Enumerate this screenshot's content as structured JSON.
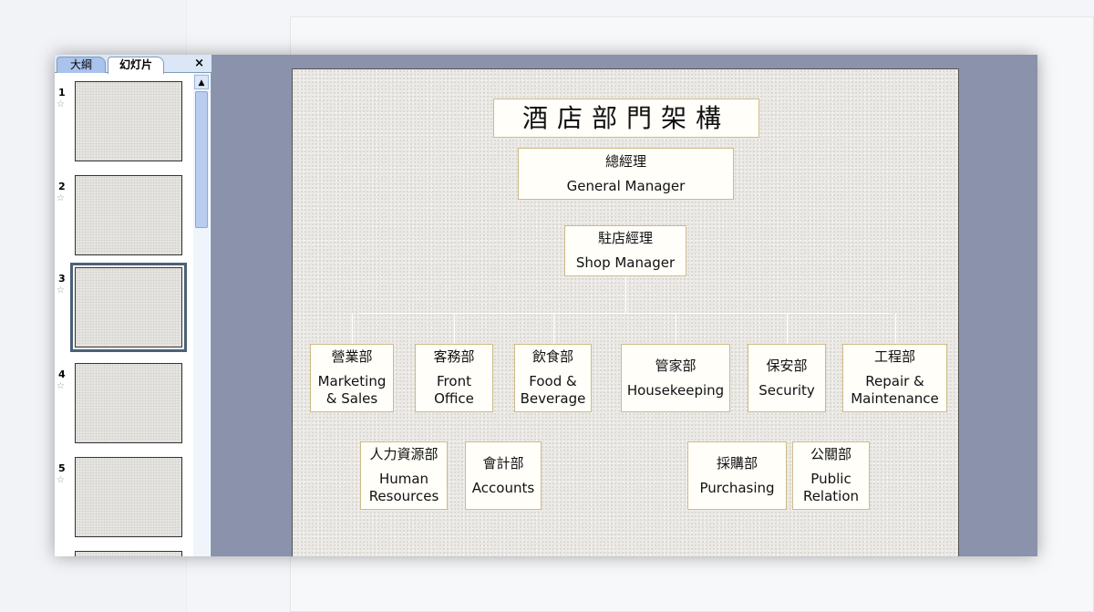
{
  "panel": {
    "tabs": [
      "大綱",
      "幻灯片"
    ],
    "close": "×"
  },
  "slides": [
    {
      "num": "1"
    },
    {
      "num": "2"
    },
    {
      "num": "3",
      "selected": true
    },
    {
      "num": "4"
    },
    {
      "num": "5"
    }
  ],
  "slide": {
    "title": "酒店部門架構",
    "gm": {
      "zh": "總經理",
      "en": "General Manager"
    },
    "shop": {
      "zh": "駐店經理",
      "en": "Shop Manager"
    },
    "depts": [
      {
        "zh": "營業部",
        "en": "Marketing & Sales"
      },
      {
        "zh": "客務部",
        "en": "Front Office"
      },
      {
        "zh": "飲食部",
        "en": "Food & Beverage"
      },
      {
        "zh": "管家部",
        "en": "Housekeeping"
      },
      {
        "zh": "保安部",
        "en": "Security"
      },
      {
        "zh": "工程部",
        "en": "Repair & Maintenance"
      },
      {
        "zh": "人力資源部",
        "en": "Human Resources"
      },
      {
        "zh": "會計部",
        "en": "Accounts"
      },
      {
        "zh": "採購部",
        "en": "Purchasing"
      },
      {
        "zh": "公關部",
        "en": "Public Relation"
      }
    ]
  }
}
